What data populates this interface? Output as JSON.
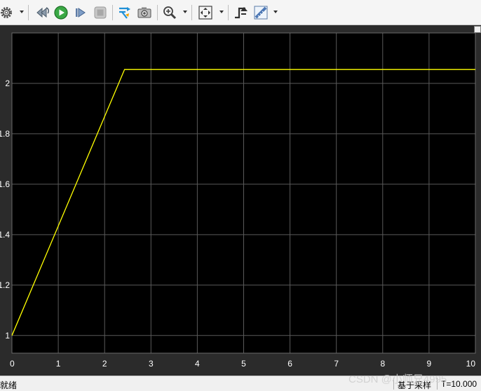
{
  "toolbar": {
    "buttons": [
      {
        "name": "settings",
        "icon": "gear-icon",
        "has_dropdown": true
      },
      {
        "name": "step-back",
        "icon": "step-back-icon"
      },
      {
        "name": "run",
        "icon": "run-icon",
        "accent": "#2e9e3a"
      },
      {
        "name": "step-forward",
        "icon": "step-forward-icon"
      },
      {
        "name": "stop",
        "icon": "stop-icon"
      },
      {
        "name": "highlight-signal",
        "icon": "signal-highlight-icon"
      },
      {
        "name": "snapshot",
        "icon": "camera-icon"
      },
      {
        "name": "zoom",
        "icon": "zoom-in-icon",
        "has_dropdown": true
      },
      {
        "name": "autoscale",
        "icon": "fit-axes-icon",
        "has_dropdown": true
      },
      {
        "name": "triggers",
        "icon": "trigger-icon"
      },
      {
        "name": "measurements",
        "icon": "ruler-icon",
        "has_dropdown": true
      }
    ]
  },
  "status": {
    "ready": "就绪",
    "sample_mode": "基于采样",
    "time": "T=10.000"
  },
  "watermark": "CSDN @小师兄4995",
  "colors": {
    "plot_background": "#000000",
    "figure_background": "#2b2b2b",
    "grid": "#5a5a5a",
    "trace": "#ffff00",
    "tick_label": "#ffffff"
  },
  "chart_data": {
    "type": "line",
    "xlim": [
      0,
      10
    ],
    "ylim": [
      0.93,
      2.2
    ],
    "xticks": [
      0,
      1,
      2,
      3,
      4,
      5,
      6,
      7,
      8,
      9,
      10
    ],
    "xtick_labels": [
      "0",
      "1",
      "2",
      "3",
      "4",
      "5",
      "6",
      "7",
      "8",
      "9",
      "10"
    ],
    "yticks": [
      1.0,
      1.2,
      1.4,
      1.6,
      1.8,
      2.0
    ],
    "ytick_labels": [
      "1",
      "1.2",
      "1.4",
      "1.6",
      "1.8",
      "2"
    ],
    "grid": true,
    "series": [
      {
        "x": [
          0,
          2.43,
          10
        ],
        "y": [
          1.0,
          2.055,
          2.055
        ]
      }
    ]
  }
}
